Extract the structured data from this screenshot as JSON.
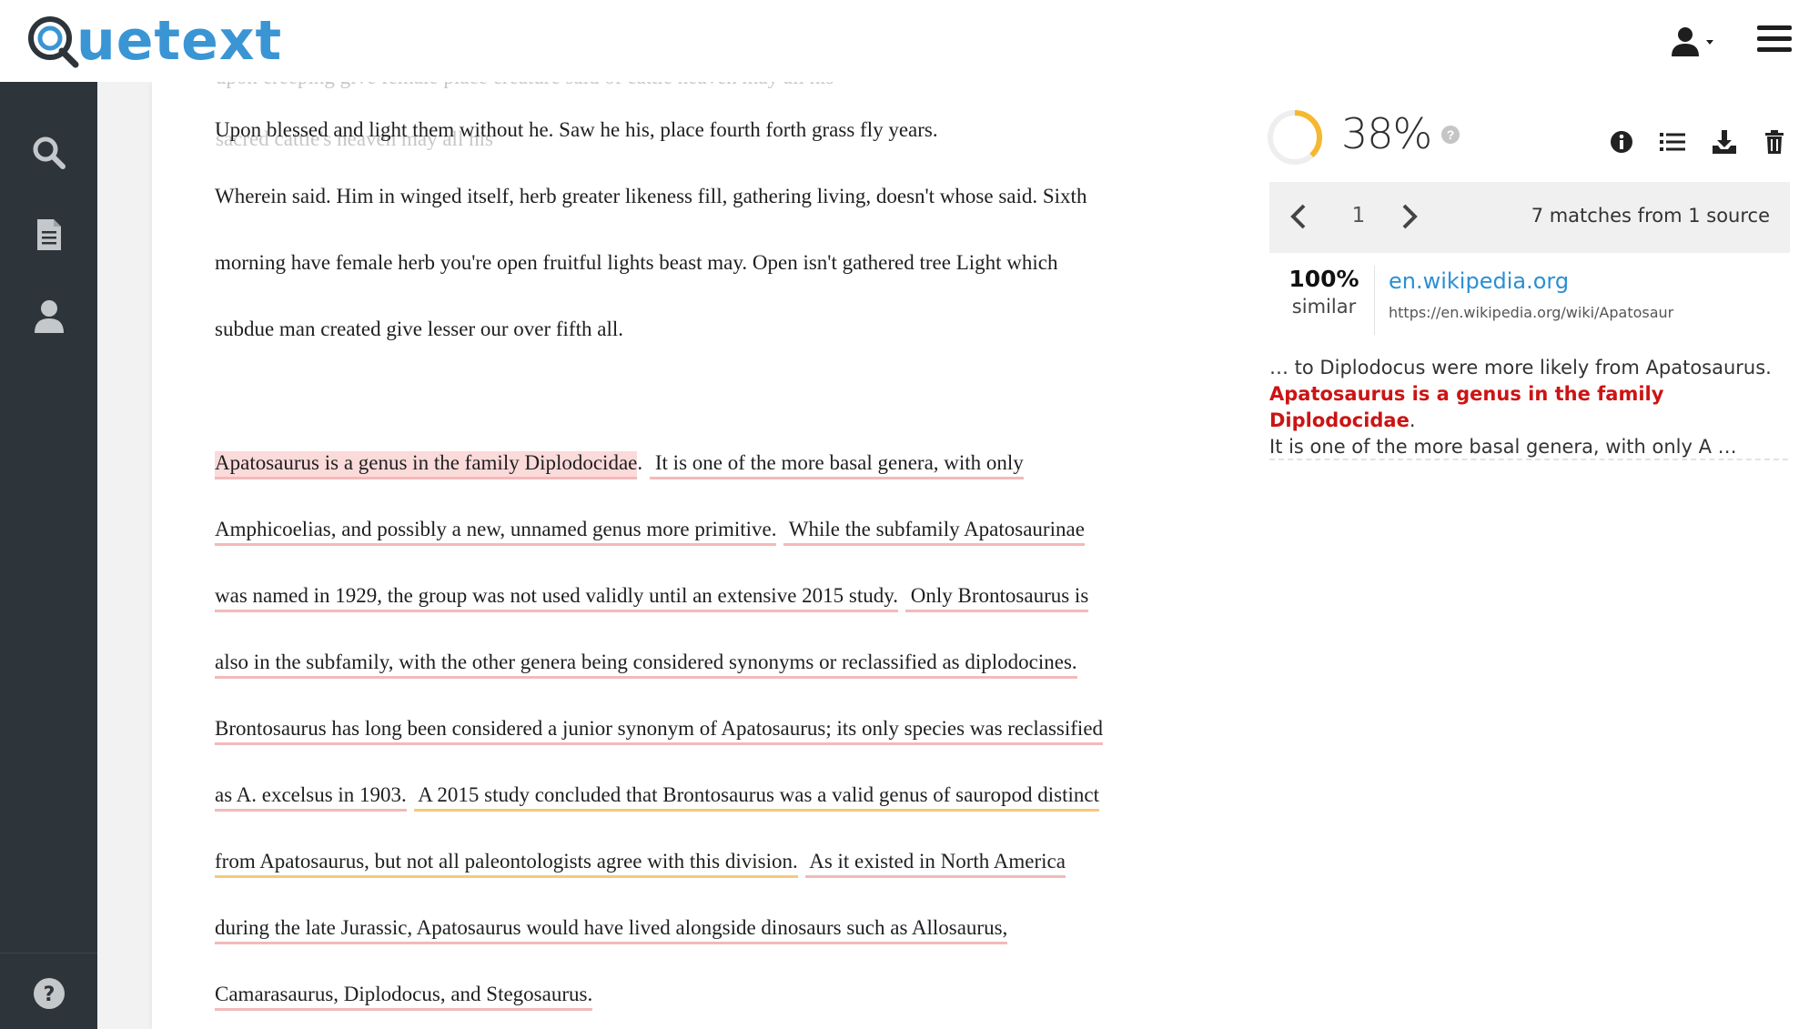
{
  "app": {
    "name": "Quetext",
    "logo_text": "uetext"
  },
  "header": {
    "user_menu_icon": "user-icon",
    "hamburger_icon": "menu-icon"
  },
  "sidebar": {
    "items": [
      {
        "icon": "search-icon"
      },
      {
        "icon": "document-icon"
      },
      {
        "icon": "user-icon"
      }
    ],
    "help_icon": "help-icon"
  },
  "document": {
    "ghost_lines": [
      "upon creeping give female place creature said of cattle heaven may all his",
      "sacred cattle's heaven may all his"
    ],
    "plain_paragraph": [
      "Upon blessed and light them without he. Saw he his, place fourth forth grass fly years.",
      "Wherein said. Him in winged itself, herb greater likeness fill, gathering living, doesn't whose said. Sixth",
      "morning have female herb you're open fruitful lights beast may. Open isn't gathered tree Light which",
      "subdue man created give lesser our over fifth all."
    ],
    "matched_paragraph": [
      {
        "segments": [
          {
            "text": "Apatosaurus is a genus in the family Diplodocidae",
            "style": "first"
          },
          {
            "text": ".",
            "style": "plain"
          },
          {
            "text": " It is one of the more basal genera, with only",
            "style": "pink"
          }
        ]
      },
      {
        "segments": [
          {
            "text": "Amphicoelias, and possibly a new, unnamed genus more primitive.",
            "style": "pink"
          },
          {
            "text": " While the subfamily Apatosaurinae",
            "style": "pink"
          }
        ]
      },
      {
        "segments": [
          {
            "text": "was named in 1929, the group was not used validly until an extensive 2015 study.",
            "style": "pink"
          },
          {
            "text": " Only Brontosaurus is",
            "style": "pink"
          }
        ]
      },
      {
        "segments": [
          {
            "text": "also in the subfamily, with the other genera being considered synonyms or reclassified as diplodocines.",
            "style": "pink"
          }
        ]
      },
      {
        "segments": [
          {
            "text": "Brontosaurus has long been considered a junior synonym of Apatosaurus; its only species was reclassified",
            "style": "pink"
          }
        ]
      },
      {
        "segments": [
          {
            "text": "as A. excelsus in 1903.",
            "style": "pink"
          },
          {
            "text": " A 2015 study concluded that Brontosaurus was a valid genus of sauropod distinct",
            "style": "orange"
          }
        ]
      },
      {
        "segments": [
          {
            "text": "from Apatosaurus, but not all paleontologists agree with this division.",
            "style": "orange"
          },
          {
            "text": " As it existed in North America",
            "style": "pink"
          }
        ]
      },
      {
        "segments": [
          {
            "text": "during the late Jurassic, Apatosaurus would have lived alongside dinosaurs such as Allosaurus,",
            "style": "pink"
          }
        ]
      },
      {
        "segments": [
          {
            "text": "Camarasaurus, Diplodocus, and Stegosaurus.",
            "style": "pink"
          }
        ]
      }
    ]
  },
  "results": {
    "score_text": "38%",
    "score_fraction": 0.38,
    "score_help_icon": "question-icon",
    "tools": [
      "info-icon",
      "list-icon",
      "download-icon",
      "trash-icon"
    ],
    "pagination": {
      "prev_icon": "chevron-left-icon",
      "page": "1",
      "next_icon": "chevron-right-icon",
      "matches_text": "7 matches from 1 source"
    },
    "source": {
      "similarity": "100%",
      "similarity_label": "similar",
      "domain": "en.wikipedia.org",
      "url": "https://en.wikipedia.org/wiki/Apatosaur"
    },
    "excerpt": {
      "before": "… to Diplodocus were more likely from Apatosaurus.",
      "highlight": "Apatosaurus is a genus in the family Diplodocidae",
      "highlight_end": ".",
      "after": "It is one of the more basal genera, with only A …"
    }
  },
  "colors": {
    "brand_blue": "#3a95d4",
    "sidebar_bg": "#2d343a",
    "highlight_red": "#cc1414",
    "underline_pink": "#f3b9b9",
    "underline_orange": "#f6c97c",
    "score_ring": "#f5b82e"
  }
}
